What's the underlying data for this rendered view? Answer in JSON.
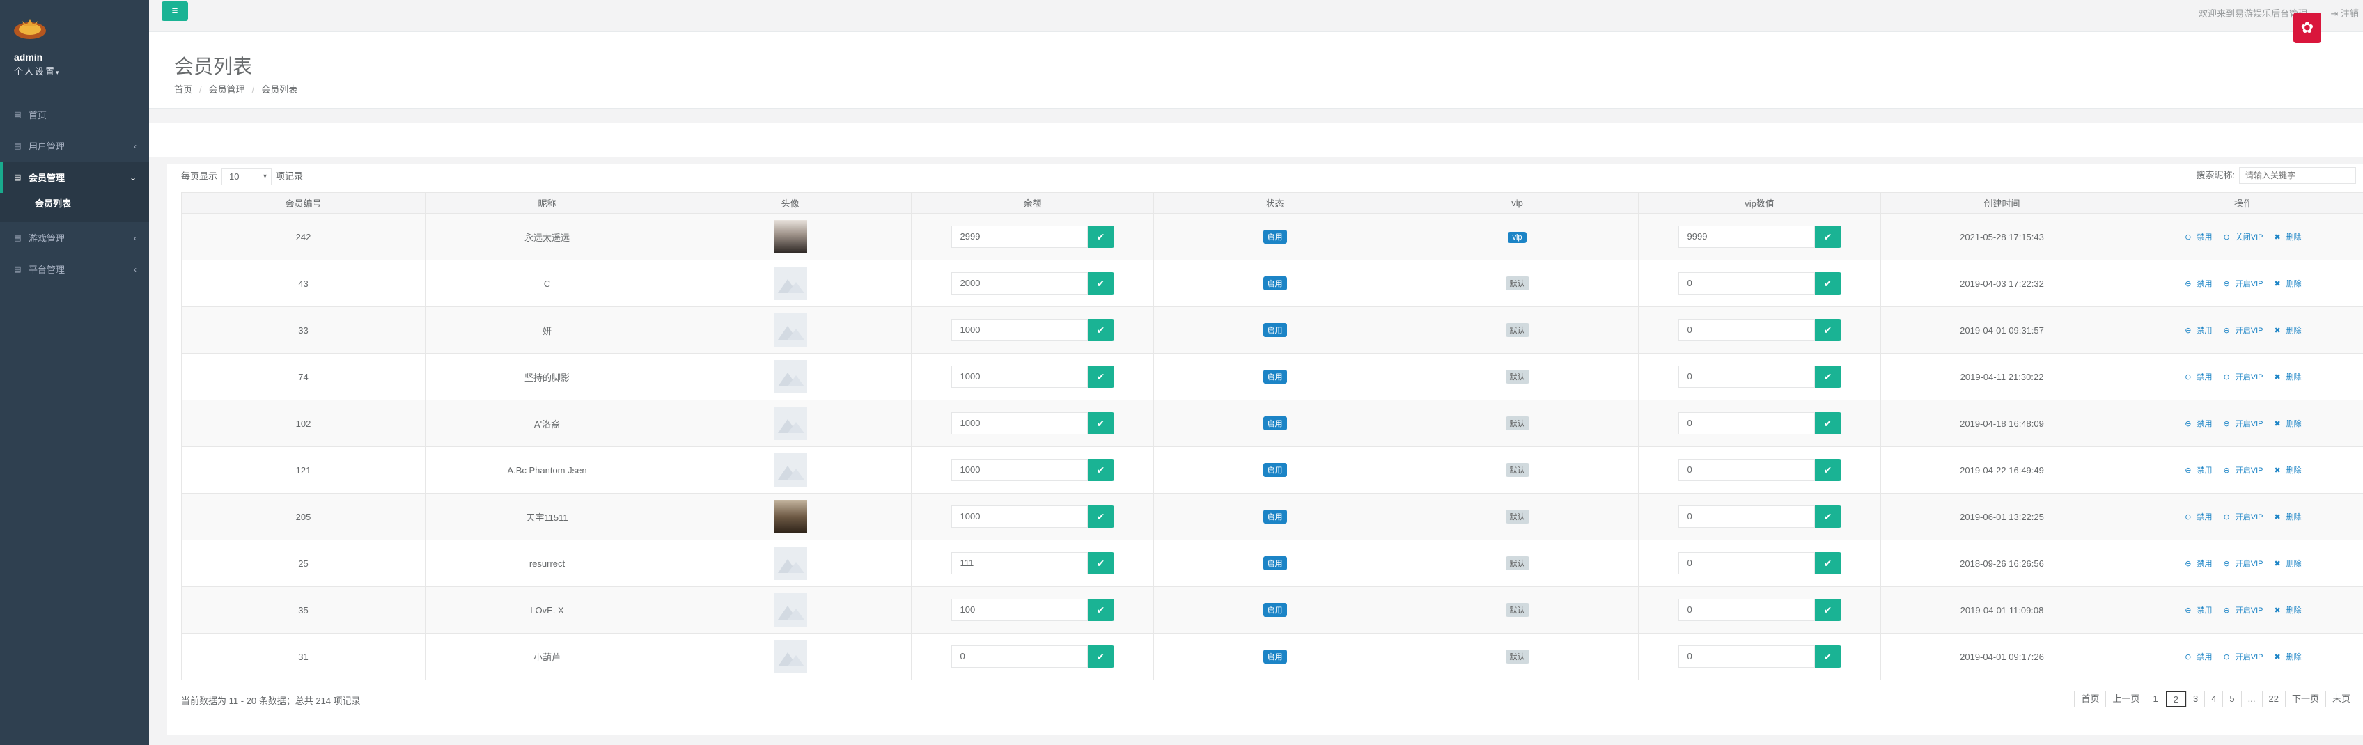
{
  "sidebar": {
    "username": "admin",
    "settings": "个人设置",
    "items": [
      {
        "label": "首页",
        "icon": "home-icon"
      },
      {
        "label": "用户管理",
        "icon": "users-icon"
      },
      {
        "label": "会员管理",
        "icon": "members-icon"
      },
      {
        "label": "游戏管理",
        "icon": "game-icon"
      },
      {
        "label": "平台管理",
        "icon": "platform-icon"
      }
    ],
    "sub_item": "会员列表"
  },
  "topbar": {
    "welcome": "欢迎来到易游娱乐后台管理",
    "logout": "注销"
  },
  "page": {
    "title": "会员列表",
    "breadcrumb": [
      "首页",
      "会员管理",
      "会员列表"
    ]
  },
  "table_controls": {
    "show_prefix": "每页显示",
    "page_size": "10",
    "show_suffix": "项记录",
    "search_label": "搜索昵称:",
    "search_placeholder": "请输入关键字"
  },
  "table": {
    "headers": [
      "会员编号",
      "昵称",
      "头像",
      "余额",
      "状态",
      "vip",
      "vip数值",
      "创建时间",
      "操作"
    ],
    "rows": [
      {
        "id": "242",
        "nick": "永远太遥远",
        "avatar": "photo",
        "balance": "2999",
        "status": "启用",
        "vip": "vip",
        "vip_value": "9999",
        "created": "2021-05-28 17:15:43",
        "vip_action": "关闭VIP"
      },
      {
        "id": "43",
        "nick": "C",
        "avatar": "placeholder",
        "balance": "2000",
        "status": "启用",
        "vip": "默认",
        "vip_value": "0",
        "created": "2019-04-03 17:22:32",
        "vip_action": "开启VIP"
      },
      {
        "id": "33",
        "nick": "妍",
        "avatar": "placeholder",
        "balance": "1000",
        "status": "启用",
        "vip": "默认",
        "vip_value": "0",
        "created": "2019-04-01 09:31:57",
        "vip_action": "开启VIP"
      },
      {
        "id": "74",
        "nick": "坚持的脚影",
        "avatar": "placeholder",
        "balance": "1000",
        "status": "启用",
        "vip": "默认",
        "vip_value": "0",
        "created": "2019-04-11 21:30:22",
        "vip_action": "开启VIP"
      },
      {
        "id": "102",
        "nick": "A'洛裔",
        "avatar": "placeholder",
        "balance": "1000",
        "status": "启用",
        "vip": "默认",
        "vip_value": "0",
        "created": "2019-04-18 16:48:09",
        "vip_action": "开启VIP"
      },
      {
        "id": "121",
        "nick": "A.Bc Phantom Jsen",
        "avatar": "placeholder",
        "balance": "1000",
        "status": "启用",
        "vip": "默认",
        "vip_value": "0",
        "created": "2019-04-22 16:49:49",
        "vip_action": "开启VIP"
      },
      {
        "id": "205",
        "nick": "天宇11511",
        "avatar": "photo2",
        "balance": "1000",
        "status": "启用",
        "vip": "默认",
        "vip_value": "0",
        "created": "2019-06-01 13:22:25",
        "vip_action": "开启VIP"
      },
      {
        "id": "25",
        "nick": "resurrect",
        "avatar": "placeholder",
        "balance": "111",
        "status": "启用",
        "vip": "默认",
        "vip_value": "0",
        "created": "2018-09-26 16:26:56",
        "vip_action": "开启VIP"
      },
      {
        "id": "35",
        "nick": "LOvE. X",
        "avatar": "placeholder",
        "balance": "100",
        "status": "启用",
        "vip": "默认",
        "vip_value": "0",
        "created": "2019-04-01 11:09:08",
        "vip_action": "开启VIP"
      },
      {
        "id": "31",
        "nick": "小葫芦",
        "avatar": "placeholder",
        "balance": "0",
        "status": "启用",
        "vip": "默认",
        "vip_value": "0",
        "created": "2019-04-01 09:17:26",
        "vip_action": "开启VIP"
      }
    ],
    "ops": {
      "disable": "禁用",
      "delete": "删除"
    }
  },
  "footer": {
    "info": "当前数据为 11 - 20 条数据；总共 214 项记录",
    "pager": [
      "首页",
      "上一页",
      "1",
      "2",
      "3",
      "4",
      "5",
      "...",
      "22",
      "下一页",
      "末页"
    ],
    "current_page": "2"
  },
  "colors": {
    "sidebar": "#2f4050",
    "accent": "#1ab394",
    "blue": "#1c84c6",
    "float": "#d9163c"
  }
}
